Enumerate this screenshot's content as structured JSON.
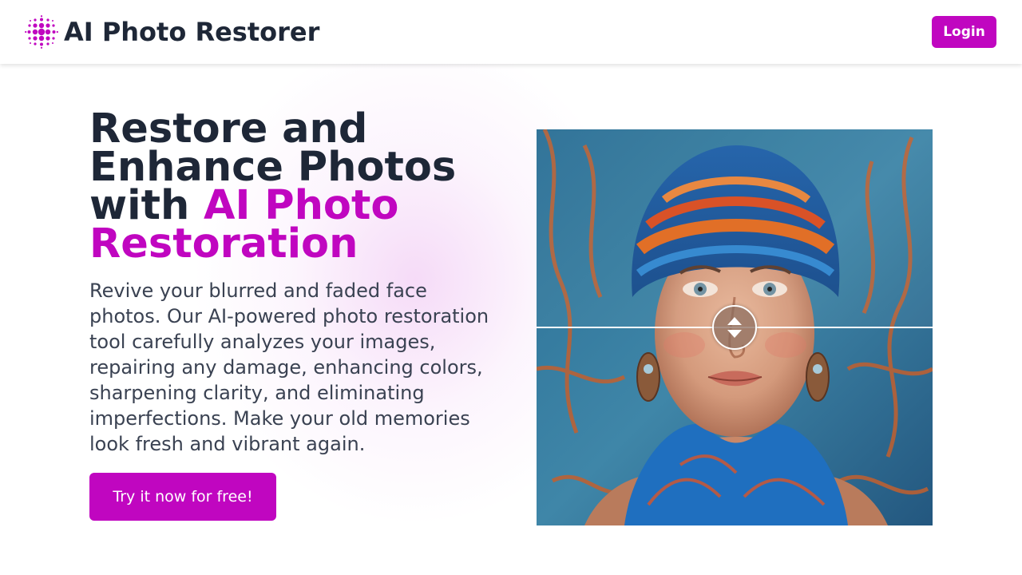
{
  "header": {
    "app_name": "AI Photo Restorer",
    "logo_icon": "dotted-burst-icon",
    "login_label": "Login"
  },
  "hero": {
    "headline_line_1": "Restore and",
    "headline_line_2": "Enhance Photos",
    "headline_with": "with ",
    "headline_accent_1": "AI Photo",
    "headline_accent_2": "Restoration",
    "description": "Revive your blurred and faded face photos. Our AI-powered photo restoration tool carefully analyzes your images, repairing any damage, enhancing colors, sharpening clarity, and eliminating imperfections. Make your old memories look fresh and vibrant again.",
    "cta_label": "Try it now for free!"
  },
  "comparison": {
    "handle_icon": "up-down-arrows-icon",
    "image_subject": "portrait-woman-headwrap"
  },
  "colors": {
    "brand": "#c006c0",
    "text_dark": "#1e2737",
    "text_body": "#3a4252"
  }
}
